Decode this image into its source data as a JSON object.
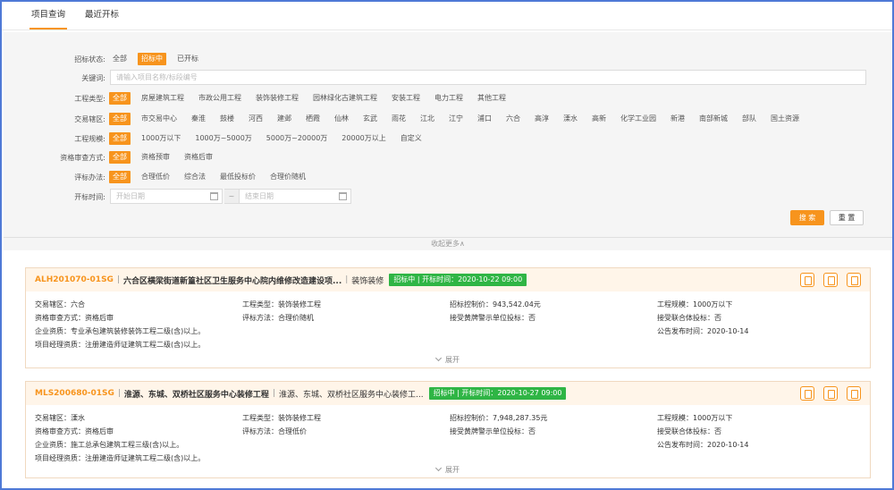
{
  "tabs": [
    {
      "label": "项目查询",
      "active": true
    },
    {
      "label": "最近开标",
      "active": false
    }
  ],
  "filter": {
    "status": {
      "label": "招标状态:",
      "options": [
        "全部",
        "招标中",
        "已开标"
      ],
      "selected": 1
    },
    "keyword": {
      "label": "关键词:",
      "placeholder": "请输入项目名称/标段编号"
    },
    "project_type": {
      "label": "工程类型:",
      "options": [
        "全部",
        "房屋建筑工程",
        "市政公用工程",
        "装饰装修工程",
        "园林绿化古建筑工程",
        "安装工程",
        "电力工程",
        "其他工程"
      ],
      "selected": 0
    },
    "district": {
      "label": "交易辖区:",
      "options": [
        "全部",
        "市交易中心",
        "秦淮",
        "鼓楼",
        "河西",
        "建邺",
        "栖霞",
        "仙林",
        "玄武",
        "雨花",
        "江北",
        "江宁",
        "浦口",
        "六合",
        "高淳",
        "溧水",
        "高新",
        "化学工业园",
        "新港",
        "南部新城",
        "部队",
        "国土资源"
      ],
      "selected": 0
    },
    "scale": {
      "label": "工程规模:",
      "options": [
        "全部",
        "1000万以下",
        "1000万~5000万",
        "5000万~20000万",
        "20000万以上",
        "自定义"
      ],
      "selected": 0
    },
    "qualification": {
      "label": "资格审查方式:",
      "options": [
        "全部",
        "资格预审",
        "资格后审"
      ],
      "selected": 0
    },
    "evaluation": {
      "label": "评标办法:",
      "options": [
        "全部",
        "合理低价",
        "综合法",
        "最低投标价",
        "合理价随机"
      ],
      "selected": 0
    },
    "open_time": {
      "label": "开标时间:",
      "start_placeholder": "开始日期",
      "end_placeholder": "结束日期",
      "sep": "~"
    },
    "search_label": "搜 索",
    "reset_label": "重 置",
    "collapse_label": "收起更多∧"
  },
  "results": [
    {
      "code": "ALH201070-01SG",
      "title": "六合区横梁街道新篁社区卫生服务中心院内维修改造建设项...",
      "type": "装饰装修",
      "status": "招标中 | 开标时间：2020-10-22 09:00",
      "fields": [
        "交易辖区：六合",
        "工程类型：装饰装修工程",
        "招标控制价：943,542.04元",
        "工程规模：1000万以下",
        "资格审查方式：资格后审",
        "评标方法：合理价随机",
        "接受黄牌警示单位投标：否",
        "接受联合体投标：否",
        "企业资质：专业承包建筑装修装饰工程二级(含)以上。",
        "",
        "",
        "公告发布时间：2020-10-14",
        "项目经理资质：注册建造师证建筑工程二级(含)以上。"
      ],
      "expand_label": "展开"
    },
    {
      "code": "MLS200680-01SG",
      "title": "淮源、东城、双桥社区服务中心装修工程",
      "type": "淮源、东城、双桥社区服务中心装修工...",
      "status": "招标中 | 开标时间：2020-10-27 09:00",
      "fields": [
        "交易辖区：溧水",
        "工程类型：装饰装修工程",
        "招标控制价：7,948,287.35元",
        "工程规模：1000万以下",
        "资格审查方式：资格后审",
        "评标方法：合理低价",
        "接受黄牌警示单位投标：否",
        "接受联合体投标：否",
        "企业资质：施工总承包建筑工程三级(含)以上。",
        "",
        "",
        "公告发布时间：2020-10-14",
        "项目经理资质：注册建造师证建筑工程二级(含)以上。"
      ],
      "expand_label": "展开"
    }
  ],
  "colors": {
    "accent": "#f7941d",
    "status_green": "#2fb545",
    "frame_border": "#4e79d6"
  }
}
